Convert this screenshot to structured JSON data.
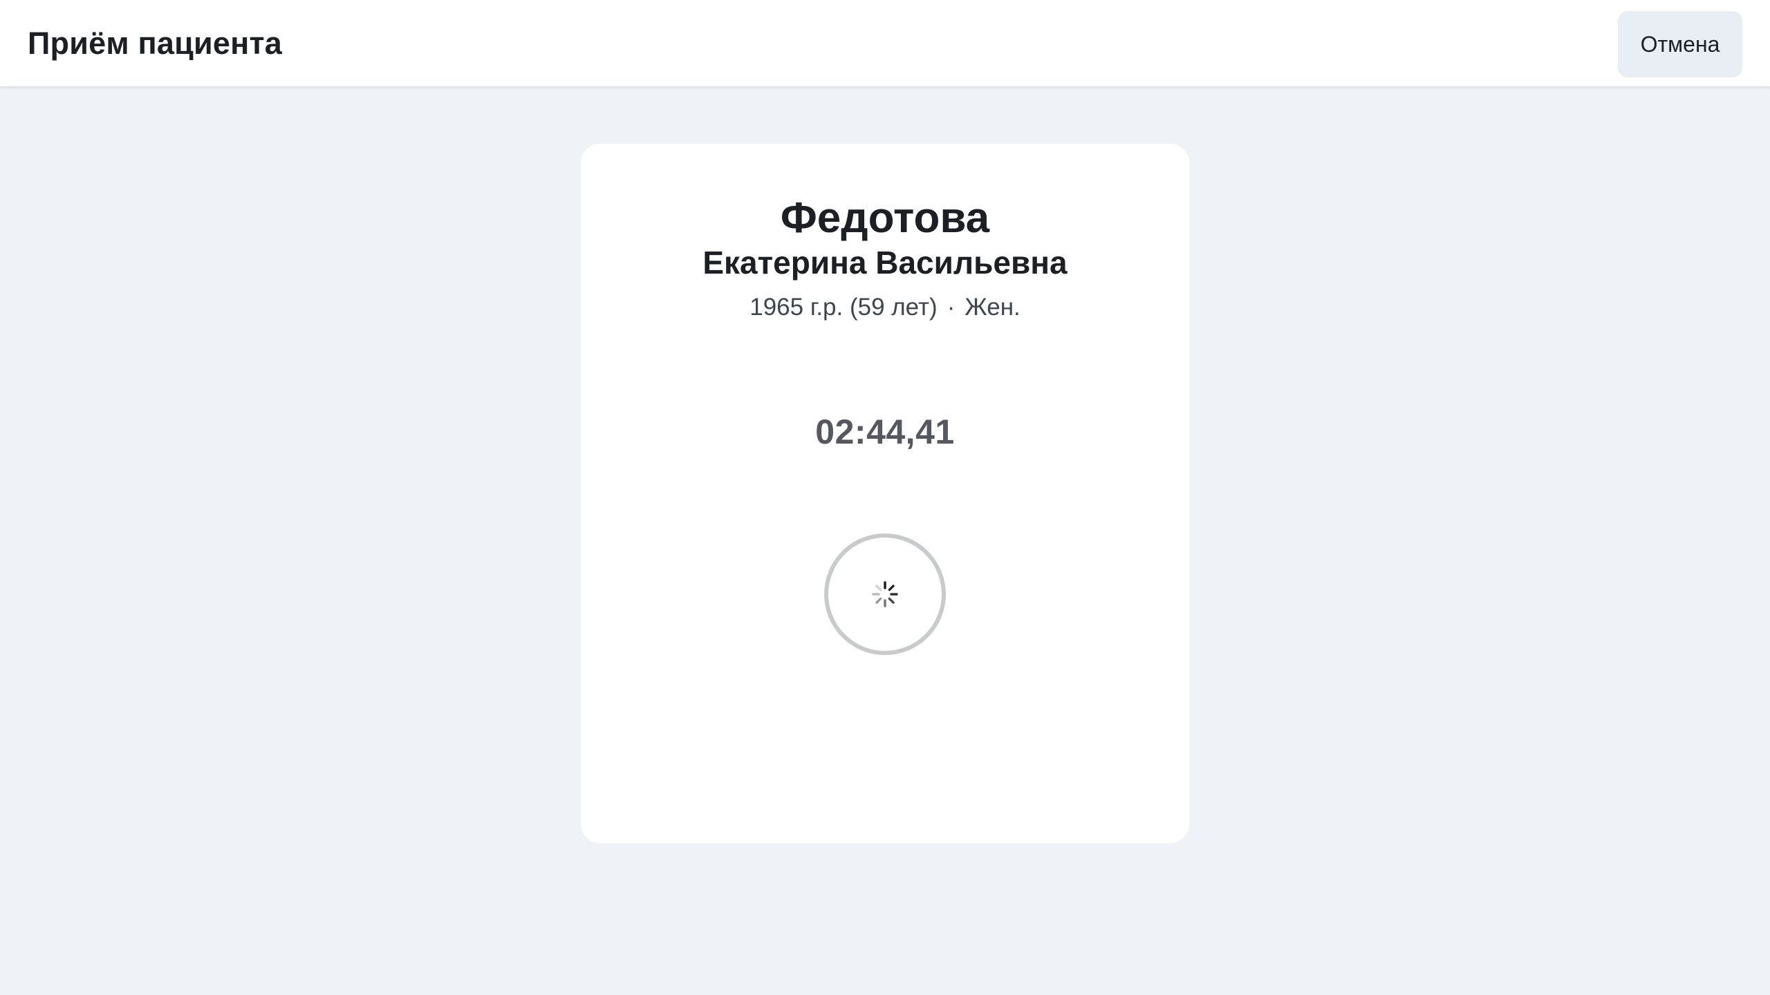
{
  "header": {
    "title": "Приём пациента",
    "cancel_label": "Отмена"
  },
  "patient": {
    "surname": "Федотова",
    "given_names": "Екатерина Васильевна",
    "birth_info": "1965 г.р. (59 лет)",
    "separator": "·",
    "sex": "Жен."
  },
  "timer": {
    "value": "02:44,41"
  },
  "loader": {
    "icon": "spinner-icon",
    "ring_color": "#c9cacc"
  }
}
